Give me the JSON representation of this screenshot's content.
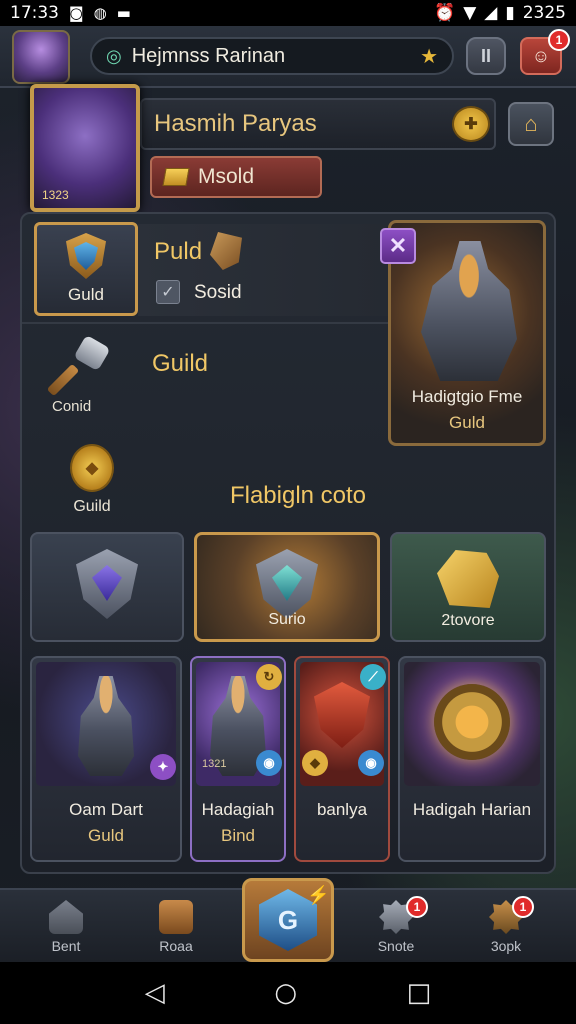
{
  "status_bar": {
    "time": "17:33",
    "right_time": "2325"
  },
  "header": {
    "search_text": "Hejmnss Rarinan",
    "star": "★",
    "pause": "II",
    "profile_badge": "1"
  },
  "hero": {
    "name": "Hasmih Paryas",
    "level": "1323",
    "gold_button_label": "Msold",
    "coin_symbol": "✚",
    "home_symbol": "⌂"
  },
  "panel": {
    "guild_card_label": "Guld",
    "puld_label": "Puld",
    "checkbox_label": "Sosid",
    "close_symbol": "✕",
    "featured": {
      "name": "Hadigtgio Fme",
      "sub": "Guld"
    },
    "hammer_label": "Conid",
    "guild_mid_label": "Guild",
    "medal_label": "Guild",
    "section_title": "Flabigln coto"
  },
  "tiles": [
    {
      "label": ""
    },
    {
      "label": "Surio"
    },
    {
      "label": "2tovore"
    }
  ],
  "cards": [
    {
      "name": "Oam Dart",
      "sub": "Guld"
    },
    {
      "name": "Hadagiah",
      "sub": "Bind",
      "level": "1321"
    },
    {
      "name": "banlya",
      "sub": ""
    },
    {
      "name": "Hadigah Harian",
      "sub": ""
    }
  ],
  "bottom_nav": {
    "items": [
      {
        "label": "Bent",
        "icon": "home-icon",
        "badge": ""
      },
      {
        "label": "Roaa",
        "icon": "bag-icon",
        "badge": ""
      },
      {
        "label": "Snote",
        "icon": "gear-icon",
        "badge": "1"
      },
      {
        "label": "3opk",
        "icon": "gear-orange-icon",
        "badge": "1"
      }
    ],
    "center_symbol": "G"
  },
  "system_nav": {
    "back": "◁",
    "home": "○",
    "recents": "□"
  },
  "colors": {
    "gold_text": "#f0c766",
    "accent_border": "#c9994c",
    "badge_red": "#e02b2b"
  }
}
